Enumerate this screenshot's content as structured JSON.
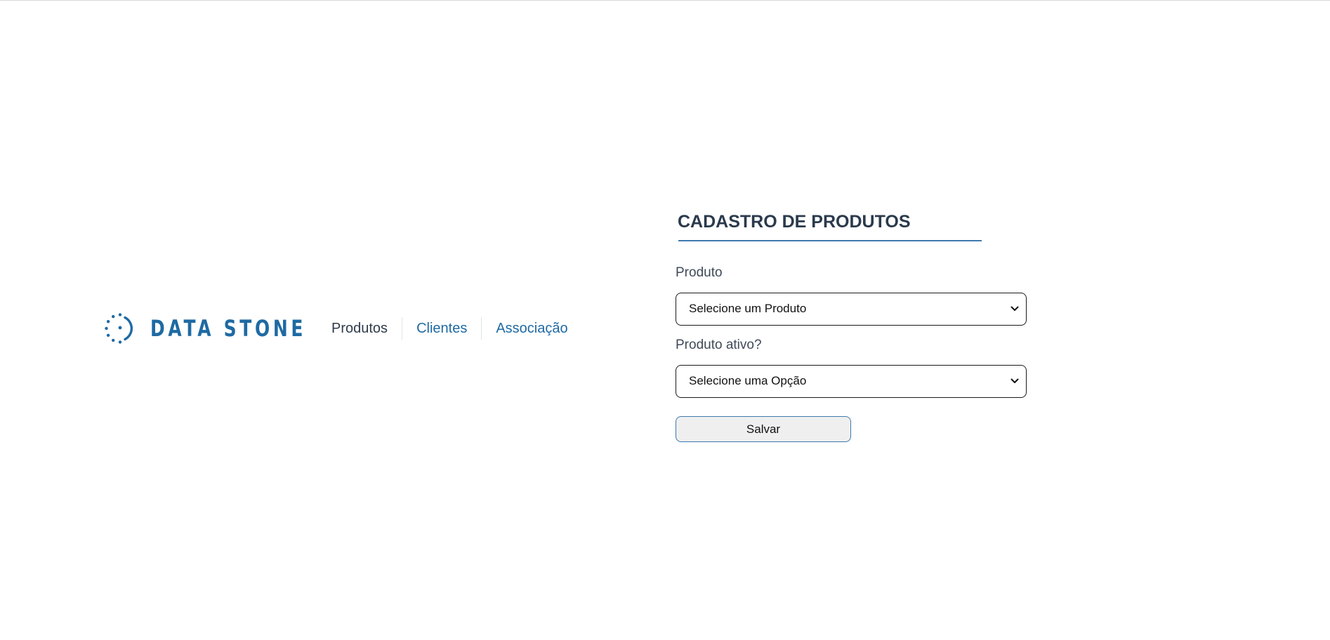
{
  "brand": {
    "name": "DATA STONE",
    "logo_icon": "dotted-circle-logo-icon",
    "color": "#1e6aa3"
  },
  "nav": {
    "items": [
      {
        "label": "Produtos",
        "active": true
      },
      {
        "label": "Clientes",
        "active": false
      },
      {
        "label": "Associação",
        "active": false
      }
    ]
  },
  "form": {
    "title": "CADASTRO DE PRODUTOS",
    "produto_label": "Produto",
    "produto_selected": "Selecione um Produto",
    "ativo_label": "Produto ativo?",
    "ativo_selected": "Selecione uma Opção",
    "save_label": "Salvar"
  },
  "colors": {
    "accent": "#1e6aa3",
    "title_text": "#2b3a4c",
    "button_bg": "#efefef",
    "button_border": "#3f79ad"
  }
}
